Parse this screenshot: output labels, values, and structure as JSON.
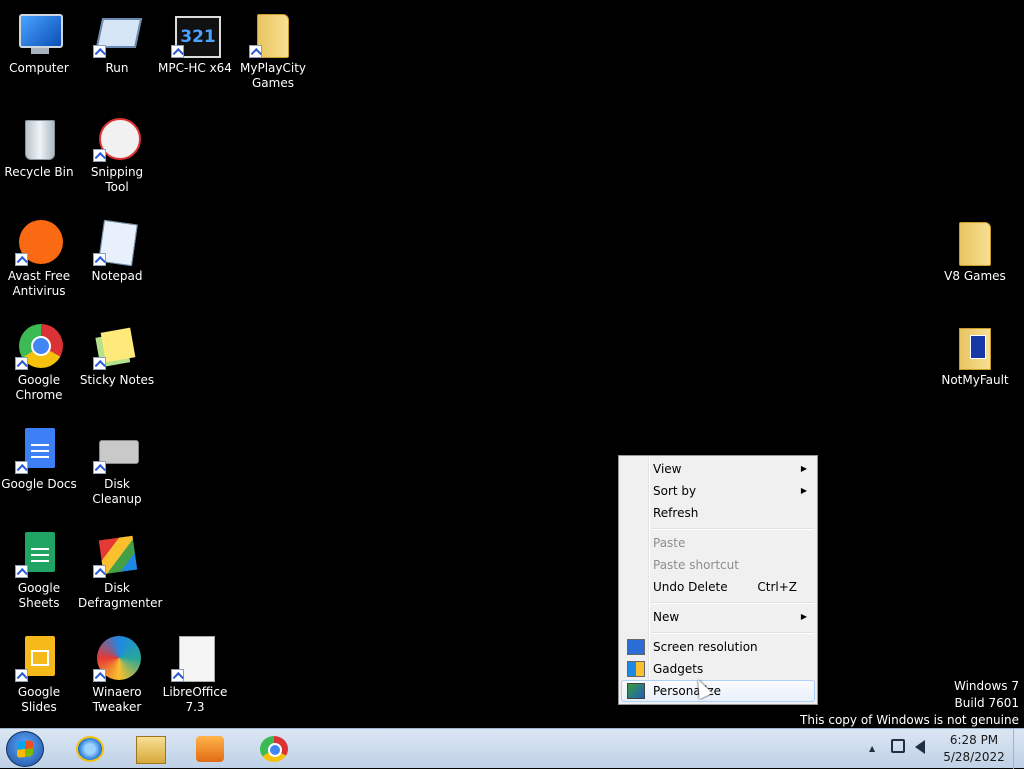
{
  "desktop_icons": [
    {
      "id": "computer",
      "label": "Computer",
      "icon": "computer-icon",
      "shortcut": false
    },
    {
      "id": "run",
      "label": "Run",
      "icon": "run-icon",
      "shortcut": true
    },
    {
      "id": "mpc",
      "label": "MPC-HC x64",
      "icon": "mpc-hc-icon",
      "shortcut": true
    },
    {
      "id": "myplaycity",
      "label": "MyPlayCity Games",
      "icon": "folder-icon",
      "shortcut": true
    },
    {
      "id": "recycle",
      "label": "Recycle Bin",
      "icon": "recycle-bin-icon",
      "shortcut": false
    },
    {
      "id": "snipping",
      "label": "Snipping Tool",
      "icon": "snipping-tool-icon",
      "shortcut": true
    },
    {
      "id": "avast",
      "label": "Avast Free Antivirus",
      "icon": "avast-icon",
      "shortcut": true
    },
    {
      "id": "notepad",
      "label": "Notepad",
      "icon": "notepad-icon",
      "shortcut": true
    },
    {
      "id": "gchrome",
      "label": "Google Chrome",
      "icon": "chrome-icon",
      "shortcut": true
    },
    {
      "id": "sticky",
      "label": "Sticky Notes",
      "icon": "sticky-notes-icon",
      "shortcut": true
    },
    {
      "id": "gdocs",
      "label": "Google Docs",
      "icon": "google-docs-icon",
      "shortcut": true
    },
    {
      "id": "diskclean",
      "label": "Disk Cleanup",
      "icon": "disk-cleanup-icon",
      "shortcut": true
    },
    {
      "id": "gsheets",
      "label": "Google Sheets",
      "icon": "google-sheets-icon",
      "shortcut": true
    },
    {
      "id": "defrag",
      "label": "Disk Defragmenter",
      "icon": "disk-defragmenter-icon",
      "shortcut": true
    },
    {
      "id": "gslides",
      "label": "Google Slides",
      "icon": "google-slides-icon",
      "shortcut": true
    },
    {
      "id": "winaero",
      "label": "Winaero Tweaker",
      "icon": "winaero-tweaker-icon",
      "shortcut": true
    },
    {
      "id": "libre",
      "label": "LibreOffice 7.3",
      "icon": "libreoffice-icon",
      "shortcut": true
    },
    {
      "id": "v8",
      "label": "V8 Games",
      "icon": "folder-icon",
      "shortcut": false
    },
    {
      "id": "notmyfault",
      "label": "NotMyFault",
      "icon": "folder-icon",
      "shortcut": false
    }
  ],
  "context_menu": {
    "items": [
      {
        "label": "View",
        "submenu": true,
        "enabled": true
      },
      {
        "label": "Sort by",
        "submenu": true,
        "enabled": true
      },
      {
        "label": "Refresh",
        "enabled": true
      },
      {
        "label": "Paste",
        "enabled": false
      },
      {
        "label": "Paste shortcut",
        "enabled": false
      },
      {
        "label": "Undo Delete",
        "shortcut": "Ctrl+Z",
        "enabled": true
      },
      {
        "label": "New",
        "submenu": true,
        "enabled": true
      },
      {
        "label": "Screen resolution",
        "icon": "screen-resolution-icon",
        "enabled": true
      },
      {
        "label": "Gadgets",
        "icon": "gadgets-icon",
        "enabled": true
      },
      {
        "label": "Personalize",
        "icon": "personalize-icon",
        "enabled": true,
        "highlighted": true
      }
    ],
    "arrow_glyph": "▶"
  },
  "watermark": {
    "line1": "Windows 7",
    "line2": "Build 7601",
    "line3": "This copy of Windows is not genuine"
  },
  "taskbar": {
    "start_icon": "windows-start-icon",
    "pinned": [
      {
        "name": "internet-explorer-icon"
      },
      {
        "name": "windows-explorer-icon"
      },
      {
        "name": "media-player-icon"
      },
      {
        "name": "chrome-icon"
      }
    ],
    "tray": {
      "show_hidden": "▲",
      "network": "network-icon",
      "volume": "volume-icon",
      "time": "6:28 PM",
      "date": "5/28/2022"
    }
  }
}
